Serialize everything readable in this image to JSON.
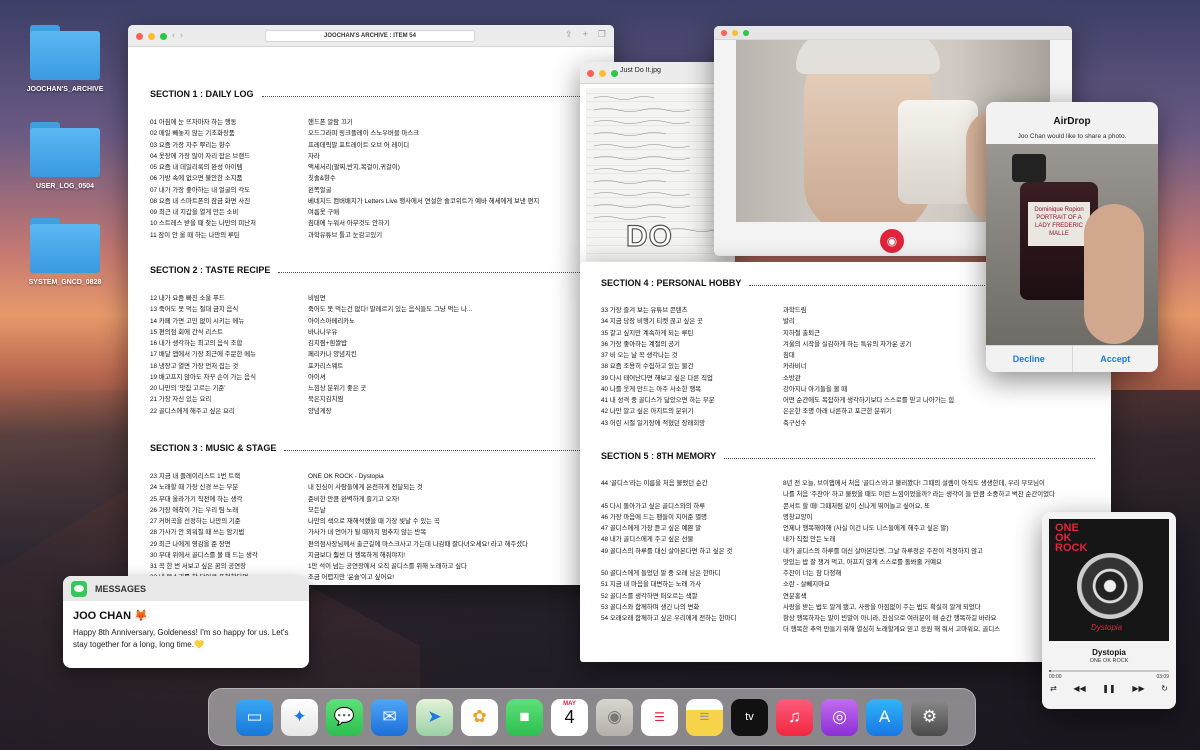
{
  "desktop": {
    "folders": [
      "JOOCHAN'S_ARCHIVE",
      "USER_LOG_0504",
      "SYSTEM_GNCD_0828"
    ]
  },
  "archive": {
    "title": "JOOCHAN'S ARCHIVE : ITEM 54",
    "sections": [
      {
        "title": "SECTION 1 : DAILY LOG",
        "rows": [
          [
            "01 아침에 눈 뜨자마자 하는 행동",
            "핸드폰 알람 끄기"
          ],
          [
            "02 매일 빼놓지 않는 기초화장품",
            "오드그라피 링크플레이 스노우버블 마스크"
          ],
          [
            "03 요즘 가장 자주 뿌리는 향수",
            "프레데릭말 포트레이트 오브 어 레이디"
          ],
          [
            "04 옷장에 가장 많이 자리 잡은 브랜드",
            "자라"
          ],
          [
            "05 요즘 내 데일리룩의 완성 아이템",
            "액세서리(팔찌,반지,목걸이,귀걸이)"
          ],
          [
            "06 가방 속에 없으면 불안한 소지품",
            "칫솔&향수"
          ],
          [
            "07 내가 가장 좋아하는 내 얼굴의 각도",
            "왼쪽얼굴"
          ],
          [
            "08 요즘 내 스마트폰의 잠금 화면 사진",
            "베네치드 컴버배치가 Letters Live 행사에서 연설한 솔코위트가 예바 헤세에게 보낸 편지"
          ],
          [
            "09 최근 내 지갑을 열게 만든 소비",
            "여름옷 구매"
          ],
          [
            "10 스트레스 받을 때 찾는 나만의 피난처",
            "침대에 누워서 아무것도 안하기"
          ],
          [
            "11 잠이 안 올 때 하는 나만의 루틴",
            "과학유튜브 틀고 눈감고있기"
          ]
        ]
      },
      {
        "title": "SECTION 2 : TASTE RECIPE",
        "rows": [
          [
            "12 내가 요즘 빠진 소울 푸드",
            "비빔면"
          ],
          [
            "13 죽어도 못 먹는 절대 금지 음식",
            "죽어도 못 먹는건 없다! 말레르기 있는 음식들도 그냥 먹는 나..."
          ],
          [
            "14 카페 가면 고민 없이 시키는 메뉴",
            "아이스아메리카노"
          ],
          [
            "15 편의점 회에 간식 리스트",
            "바나나우유"
          ],
          [
            "16 내가 생각하는 최고의 음식 조합",
            "김치찜+흰쌀밥"
          ],
          [
            "17 배달 앱에서 가장 최근에 주문한 메뉴",
            "페리카나 양념치킨"
          ],
          [
            "18 냉장고 열면 가장 먼저 집는 것",
            "포카리스웨트"
          ],
          [
            "19 배고프지 않아도 자꾸 손이 가는 음식",
            "아이셔"
          ],
          [
            "20 나만의 '맛집 고르는 기준'",
            "느낌상 분위기 좋은 곳"
          ],
          [
            "21 가장 자신 있는 요리",
            "묵은지김치찜"
          ],
          [
            "22 골디스에게 해주고 싶은 요리",
            "양념게장"
          ]
        ]
      },
      {
        "title": "SECTION 3 : MUSIC & STAGE",
        "rows": [
          [
            "23 지금 내 플레이리스트 1번 트랙",
            "ONE OK ROCK - Dystopia"
          ],
          [
            "24 노래할 때 가장 신경 쓰는 부분",
            "내 진심이 사람들에게 온전하게 전달되는 것"
          ],
          [
            "25 무대 올라가기 직전에 하는 생각",
            "준비한 만큼 완벽하게 즐기고 오자!"
          ],
          [
            "26 가장 애착이 가는 우리 팀 노래",
            "모든날"
          ],
          [
            "27 커버곡을 선정하는 나만의 기준",
            "나만의 색으로 재해석했을 때 가장 빛날 수 있는 곡"
          ],
          [
            "28 가사가 안 외워질 때 쓰는 암기법",
            "가사가 내 언어가 될 때까지 멈추지 않는 반복"
          ],
          [
            "29 최근 나에게 영감을 준 장면",
            "편의점사장님께서 출근길에 마스크사고 가는데 나감때 잘다녀오세요! 라고 해주셨다"
          ],
          [
            "30 무대 위에서 골디스를 볼 때 드는 생각",
            "지금보다 훨씬 더 행복하게 해줘야지!"
          ],
          [
            "31 꼭 한 번 서보고 싶은 꿈의 공연장",
            "1만 석이 넘는 공연장에서 오직 골디스를 위해 노래하고 싶다"
          ],
          [
            "32 내 목소리를 한 단어로 표현한다면",
            "조금 어렵지만 '윤슬'이고 싶어요!"
          ]
        ]
      }
    ]
  },
  "note": {
    "title": "Just Do It.jpg",
    "big": "DO"
  },
  "hobby": {
    "sections": [
      {
        "title": "SECTION 4 : PERSONAL HOBBY",
        "rows": [
          [
            "33 가장 즐겨 보는 유튜브 콘텐츠",
            "과학드림"
          ],
          [
            "34 지금 당장 비행기 티켓 끊고 싶은 곳",
            "발리"
          ],
          [
            "35 갈고 싶지만 계속하게 되는 루틴",
            "지하철 출퇴근"
          ],
          [
            "36 가장 좋아하는 계절의 공기",
            "겨울의 시작을 실감하게 하는 특유의 차가운 공기"
          ],
          [
            "37 비 오는 날 꼭 생각나는 것",
            "침대"
          ],
          [
            "38 요즘 조용히 수집하고 있는 물건",
            "카라비너"
          ],
          [
            "39 다시 태어난다면 해보고 싶은 다른 직업",
            "소방관"
          ],
          [
            "40 나를 웃게 만드는 아주 사소한 행복",
            "강아지나 아기들을 볼 때"
          ],
          [
            "41 내 성격 중 골디스가 닮았으면 하는 부분",
            "어떤 순간에도 복잡하게 생각하기보다 스스로를 믿고 나아가는 힘"
          ],
          [
            "42 나만 알고 싶은 아지트의 분위기",
            "은은한 조명 아래 나른하고 포근한 분위기"
          ],
          [
            "43 어린 시절 일기장에 적혔던 장래희망",
            "축구선수"
          ]
        ]
      },
      {
        "title": "SECTION 5 : 8TH MEMORY",
        "rows": [
          [
            "44 '골디스'라는 이름을 처음 불렀던 순간",
            "8년 전 오늘, 브이앱에서 처음 '골디스'라고 불러봤다! 그때의 설렘이 아직도 생생한데, 우리 부모님이"
          ],
          [
            "",
            "나를 처음 '주찬아' 하고 불렀을 때도 이런 느낌이었을까? 라는 생각이 들 만큼 소중하고 벅찬 순간이었다"
          ],
          [
            "45 다시 돌아가고 싶은 골디스와의 하루",
            "콘서트 할 때! 그때처럼 같이 신나게 뛰어놀고 싶어요, 또"
          ],
          [
            "46 가장 마음에 드는 팬들이 지어준 별명",
            "명창교양이"
          ],
          [
            "47 골디스에게 가장 듣고 싶은 예쁜 말",
            "언제나 행복해야해 (사실 이건 나도 니스들에게 해주고 싶은 말)"
          ],
          [
            "48 내가 골디스에게 주고 싶은 선물",
            "내가 직접 만든 노래"
          ],
          [
            "49 골디스의 하루를 대신 살아본다면 하고 싶은 것",
            "내가 골디스의 하루를 대신 살아본다면, 그날 하루정은 주찬이 걱정하지 않고"
          ],
          [
            "",
            "맛있는 밥 잘 챙겨 먹고, 아프지 않게 스스로를 돌봐줄 거예요"
          ],
          [
            "50 골디스에게 들었던 말 중 오래 남은 한마디",
            "주찬이 너는 참 다정해"
          ],
          [
            "51 지금 내 마음을 대변하는 노래 가사",
            "소란 - 살빼지마요"
          ],
          [
            "52 골디스를 생각하면 떠오르는 색깔",
            "연분홍색"
          ],
          [
            "53 골디스와 함께하며 생긴 나의 변화",
            "사랑을 받는 법도 알게 됐고, 사랑을 아낌없이 주는 법도 확실히 알게 되었다"
          ],
          [
            "54 오래오래 함께하고 싶은 우리에게 전하는 한마디",
            "항상 행복하자는 말이 빈말이 아니라, 진심으로 여러분이 매 순간 행복하길 바라요"
          ],
          [
            "",
            "더 행복한 추억 만들기 위해 열심히 노래할게요 믿고 응원 해 줘서 고마워요, 골디스"
          ]
        ]
      }
    ]
  },
  "airdrop": {
    "title": "AirDrop",
    "subtitle": "Joo Chan would like to share a photo.",
    "decline": "Decline",
    "accept": "Accept",
    "bottle_text": "Dominique Ropion PORTRAIT OF A LADY FREDERIC MALLE"
  },
  "messages": {
    "app": "MESSAGES",
    "sender": "JOO CHAN 🦊",
    "text": "Happy 8th Anniversary, Goldeness! I'm so happy for us. Let's stay together for a long, long time.💛"
  },
  "music": {
    "album_top": "ONE OK ROCK",
    "album_word": "Dystopia",
    "track": "Dystopia",
    "artist": "ONE OK ROCK",
    "elapsed": "00:00",
    "remaining": "03:09",
    "progress": 0.02
  },
  "dock": {
    "cal_month": "MAY",
    "cal_day": "4",
    "tv": "tv"
  },
  "colors": {
    "accent": "#1f7ae0",
    "red": "#e0243a",
    "green": "#34c759"
  }
}
